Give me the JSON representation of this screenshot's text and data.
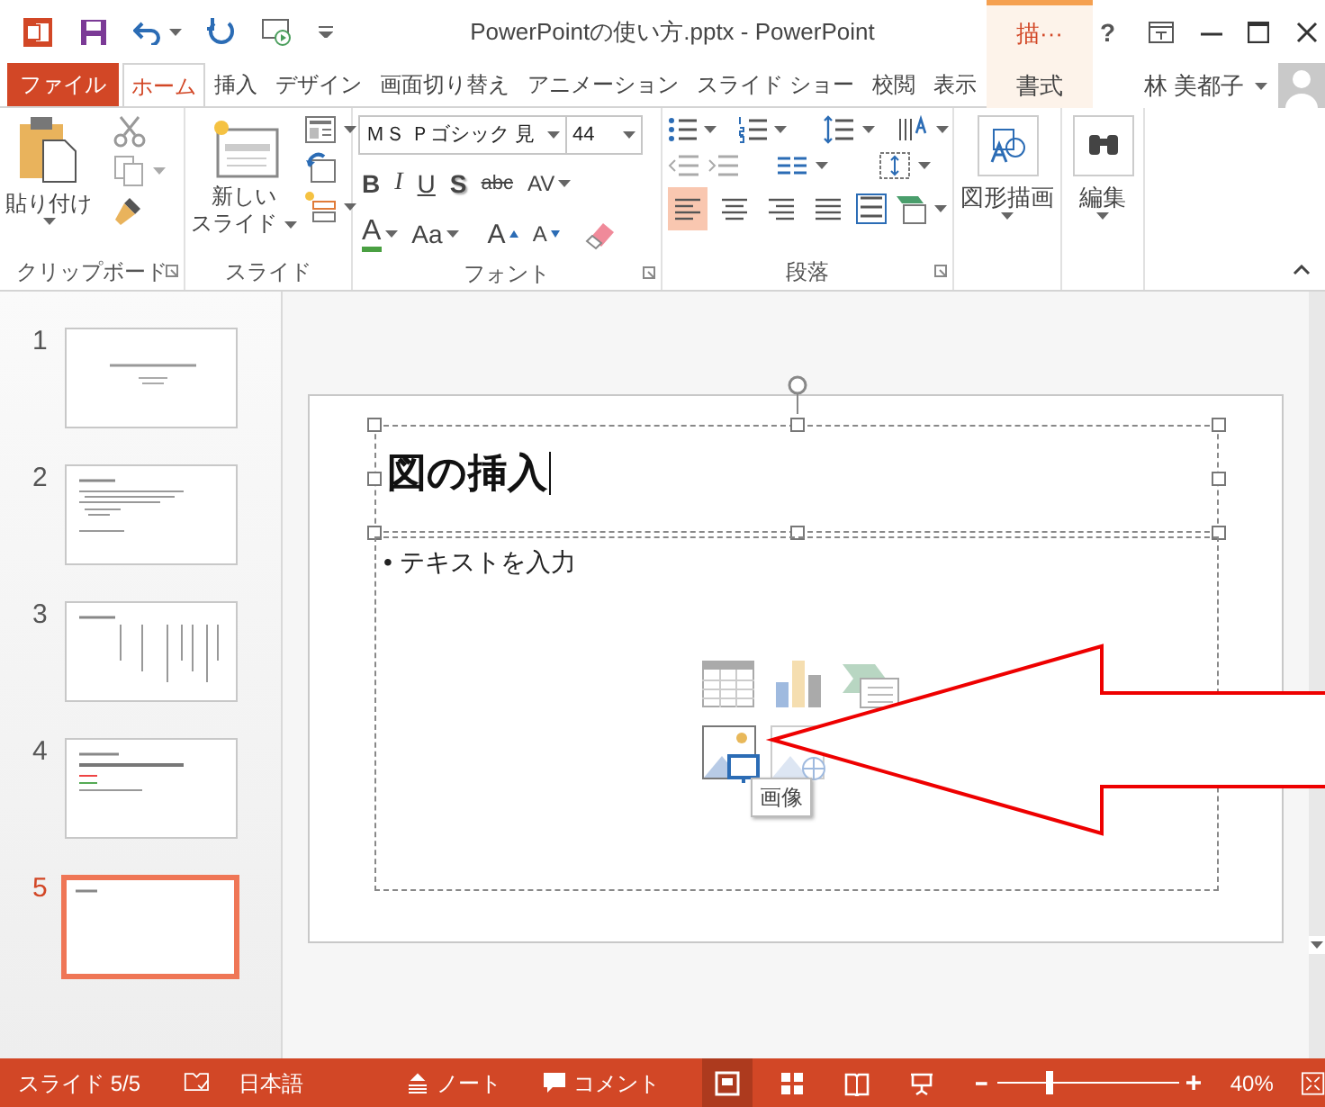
{
  "window": {
    "title": "PowerPointの使い方.pptx - PowerPoint",
    "context_label": "描···",
    "help": "?"
  },
  "tabs": [
    {
      "label": "ファイル",
      "kind": "file",
      "selected": false
    },
    {
      "label": "ホーム",
      "kind": "tab",
      "selected": true
    },
    {
      "label": "挿入",
      "kind": "tab",
      "selected": false
    },
    {
      "label": "デザイン",
      "kind": "tab",
      "selected": false
    },
    {
      "label": "画面切り替え",
      "kind": "tab",
      "selected": false
    },
    {
      "label": "アニメーション",
      "kind": "tab",
      "selected": false
    },
    {
      "label": "スライド ショー",
      "kind": "tab",
      "selected": false
    },
    {
      "label": "校閲",
      "kind": "tab",
      "selected": false
    },
    {
      "label": "表示",
      "kind": "tab",
      "selected": false
    },
    {
      "label": "書式",
      "kind": "contextual",
      "selected": false
    }
  ],
  "user": {
    "name": "林 美都子"
  },
  "ribbon": {
    "clipboard": {
      "paste": "貼り付け",
      "group": "クリップボード"
    },
    "slides": {
      "new_slide": [
        "新しい",
        "スライド"
      ],
      "group": "スライド"
    },
    "font": {
      "name": "ＭＳ Ｐゴシック 見",
      "size": "44",
      "format_buttons": [
        "B",
        "I",
        "U",
        "S",
        "abc",
        "AV"
      ],
      "color_button": "A",
      "case_button": "Aa",
      "grow_button": "A",
      "shrink_button": "A",
      "group": "フォント"
    },
    "paragraph": {
      "align": [
        {
          "selected": true
        },
        {
          "selected": false
        },
        {
          "selected": false
        },
        {
          "selected": false
        }
      ],
      "group": "段落"
    },
    "drawing": {
      "label": "図形描画"
    },
    "editing": {
      "label": "編集"
    }
  },
  "thumbnails": [
    {
      "number": "1",
      "kind": "title-slide",
      "selected": false
    },
    {
      "number": "2",
      "kind": "bullets",
      "selected": false
    },
    {
      "number": "3",
      "kind": "vertical",
      "selected": false
    },
    {
      "number": "4",
      "kind": "colored",
      "selected": false
    },
    {
      "number": "5",
      "kind": "heading",
      "selected": true
    }
  ],
  "slide": {
    "title": "図の挿入",
    "bullet": "•",
    "body": "テキストを入力",
    "tooltip": "画像"
  },
  "status_bar": {
    "slide": "スライド 5/5",
    "language": "日本語",
    "notes": "ノート",
    "comments": "コメント",
    "views": [
      {
        "selected": true
      },
      {
        "selected": false
      },
      {
        "selected": false
      },
      {
        "selected": false
      }
    ],
    "zoom_level": {
      "level": 0.27
    },
    "zoom": "40%"
  }
}
